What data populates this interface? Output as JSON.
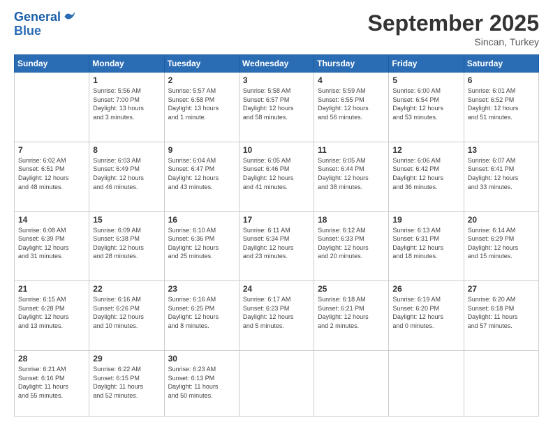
{
  "header": {
    "logo_line1": "General",
    "logo_line2": "Blue",
    "month": "September 2025",
    "location": "Sincan, Turkey"
  },
  "weekdays": [
    "Sunday",
    "Monday",
    "Tuesday",
    "Wednesday",
    "Thursday",
    "Friday",
    "Saturday"
  ],
  "weeks": [
    [
      {
        "day": "",
        "info": ""
      },
      {
        "day": "1",
        "info": "Sunrise: 5:56 AM\nSunset: 7:00 PM\nDaylight: 13 hours\nand 3 minutes."
      },
      {
        "day": "2",
        "info": "Sunrise: 5:57 AM\nSunset: 6:58 PM\nDaylight: 13 hours\nand 1 minute."
      },
      {
        "day": "3",
        "info": "Sunrise: 5:58 AM\nSunset: 6:57 PM\nDaylight: 12 hours\nand 58 minutes."
      },
      {
        "day": "4",
        "info": "Sunrise: 5:59 AM\nSunset: 6:55 PM\nDaylight: 12 hours\nand 56 minutes."
      },
      {
        "day": "5",
        "info": "Sunrise: 6:00 AM\nSunset: 6:54 PM\nDaylight: 12 hours\nand 53 minutes."
      },
      {
        "day": "6",
        "info": "Sunrise: 6:01 AM\nSunset: 6:52 PM\nDaylight: 12 hours\nand 51 minutes."
      }
    ],
    [
      {
        "day": "7",
        "info": "Sunrise: 6:02 AM\nSunset: 6:51 PM\nDaylight: 12 hours\nand 48 minutes."
      },
      {
        "day": "8",
        "info": "Sunrise: 6:03 AM\nSunset: 6:49 PM\nDaylight: 12 hours\nand 46 minutes."
      },
      {
        "day": "9",
        "info": "Sunrise: 6:04 AM\nSunset: 6:47 PM\nDaylight: 12 hours\nand 43 minutes."
      },
      {
        "day": "10",
        "info": "Sunrise: 6:05 AM\nSunset: 6:46 PM\nDaylight: 12 hours\nand 41 minutes."
      },
      {
        "day": "11",
        "info": "Sunrise: 6:05 AM\nSunset: 6:44 PM\nDaylight: 12 hours\nand 38 minutes."
      },
      {
        "day": "12",
        "info": "Sunrise: 6:06 AM\nSunset: 6:42 PM\nDaylight: 12 hours\nand 36 minutes."
      },
      {
        "day": "13",
        "info": "Sunrise: 6:07 AM\nSunset: 6:41 PM\nDaylight: 12 hours\nand 33 minutes."
      }
    ],
    [
      {
        "day": "14",
        "info": "Sunrise: 6:08 AM\nSunset: 6:39 PM\nDaylight: 12 hours\nand 31 minutes."
      },
      {
        "day": "15",
        "info": "Sunrise: 6:09 AM\nSunset: 6:38 PM\nDaylight: 12 hours\nand 28 minutes."
      },
      {
        "day": "16",
        "info": "Sunrise: 6:10 AM\nSunset: 6:36 PM\nDaylight: 12 hours\nand 25 minutes."
      },
      {
        "day": "17",
        "info": "Sunrise: 6:11 AM\nSunset: 6:34 PM\nDaylight: 12 hours\nand 23 minutes."
      },
      {
        "day": "18",
        "info": "Sunrise: 6:12 AM\nSunset: 6:33 PM\nDaylight: 12 hours\nand 20 minutes."
      },
      {
        "day": "19",
        "info": "Sunrise: 6:13 AM\nSunset: 6:31 PM\nDaylight: 12 hours\nand 18 minutes."
      },
      {
        "day": "20",
        "info": "Sunrise: 6:14 AM\nSunset: 6:29 PM\nDaylight: 12 hours\nand 15 minutes."
      }
    ],
    [
      {
        "day": "21",
        "info": "Sunrise: 6:15 AM\nSunset: 6:28 PM\nDaylight: 12 hours\nand 13 minutes."
      },
      {
        "day": "22",
        "info": "Sunrise: 6:16 AM\nSunset: 6:26 PM\nDaylight: 12 hours\nand 10 minutes."
      },
      {
        "day": "23",
        "info": "Sunrise: 6:16 AM\nSunset: 6:25 PM\nDaylight: 12 hours\nand 8 minutes."
      },
      {
        "day": "24",
        "info": "Sunrise: 6:17 AM\nSunset: 6:23 PM\nDaylight: 12 hours\nand 5 minutes."
      },
      {
        "day": "25",
        "info": "Sunrise: 6:18 AM\nSunset: 6:21 PM\nDaylight: 12 hours\nand 2 minutes."
      },
      {
        "day": "26",
        "info": "Sunrise: 6:19 AM\nSunset: 6:20 PM\nDaylight: 12 hours\nand 0 minutes."
      },
      {
        "day": "27",
        "info": "Sunrise: 6:20 AM\nSunset: 6:18 PM\nDaylight: 11 hours\nand 57 minutes."
      }
    ],
    [
      {
        "day": "28",
        "info": "Sunrise: 6:21 AM\nSunset: 6:16 PM\nDaylight: 11 hours\nand 55 minutes."
      },
      {
        "day": "29",
        "info": "Sunrise: 6:22 AM\nSunset: 6:15 PM\nDaylight: 11 hours\nand 52 minutes."
      },
      {
        "day": "30",
        "info": "Sunrise: 6:23 AM\nSunset: 6:13 PM\nDaylight: 11 hours\nand 50 minutes."
      },
      {
        "day": "",
        "info": ""
      },
      {
        "day": "",
        "info": ""
      },
      {
        "day": "",
        "info": ""
      },
      {
        "day": "",
        "info": ""
      }
    ]
  ]
}
